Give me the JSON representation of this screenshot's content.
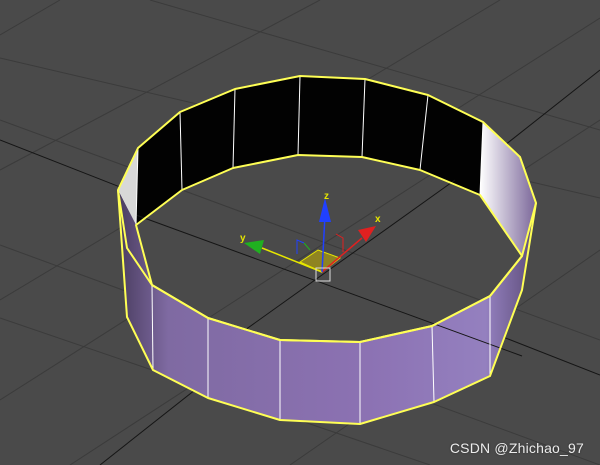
{
  "viewport": {
    "background": "#4a4a4a",
    "grid_color": "#3c3c3c",
    "home_grid_color": "#151515"
  },
  "object": {
    "type": "tube",
    "segments": 16,
    "outline_color": "#ffff55",
    "outer_color": "#8c72b3",
    "edge_color": "#ffffff"
  },
  "gizmo": {
    "x_label": "x",
    "y_label": "y",
    "z_label": "z",
    "x_color": "#e02020",
    "y_color": "#20b020",
    "z_color": "#2040ff",
    "plane_color": "#c8b400",
    "axis_label_color": "#e6e600"
  },
  "watermark": "CSDN @Zhichao_97"
}
